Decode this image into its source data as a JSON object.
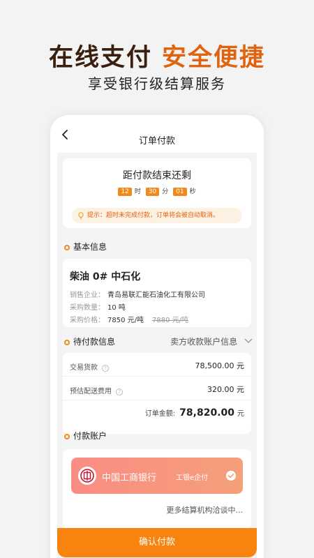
{
  "hero": {
    "title_part1": "在线支付",
    "title_part2": "安全便捷",
    "subtitle": "享受银行级结算服务"
  },
  "navbar": {
    "back_icon": "chevron-left-icon",
    "title": "订单付款"
  },
  "countdown": {
    "title": "距付款结束还剩",
    "hours": "12",
    "hours_unit": "时",
    "minutes": "30",
    "minutes_unit": "分",
    "seconds": "01",
    "seconds_unit": "秒",
    "notice": "提示：超时未完成付款，订单将会被自动取消。",
    "notice_icon": "lightbulb-icon"
  },
  "basic_section": {
    "title": "基本信息"
  },
  "product": {
    "name": "柴油 0#  中石化",
    "company_label": "销售企业：",
    "company": "青岛易联汇能石油化工有限公司",
    "quantity_label": "采购数量：",
    "quantity": "10 吨",
    "price_label": "采购价格：",
    "price": "7850  元/吨",
    "original_price": "7880  元/吨"
  },
  "payment_section": {
    "title": "待付款信息",
    "seller_account": "卖方收款账户信息"
  },
  "payment_info": {
    "goods_label": "交易货款",
    "goods_value": "78,500.00  元",
    "delivery_label": "预估配送费用",
    "delivery_value": "320.00  元",
    "total_label": "订单金额:",
    "total_value": "78,820.00",
    "total_unit": "元"
  },
  "account_section": {
    "title": "付款账户"
  },
  "account": {
    "bank_name": "中国工商银行",
    "bank_service": "工银e企付",
    "more": "更多结算机构洽谈中..."
  },
  "confirm_button": "确认付款",
  "colors": {
    "accent": "#f7840f",
    "hero_dark": "#3a1e0e",
    "hero_orange": "#e06410",
    "bank_gradient_start": "#fb8c84",
    "bank_gradient_end": "#f4a07a"
  }
}
